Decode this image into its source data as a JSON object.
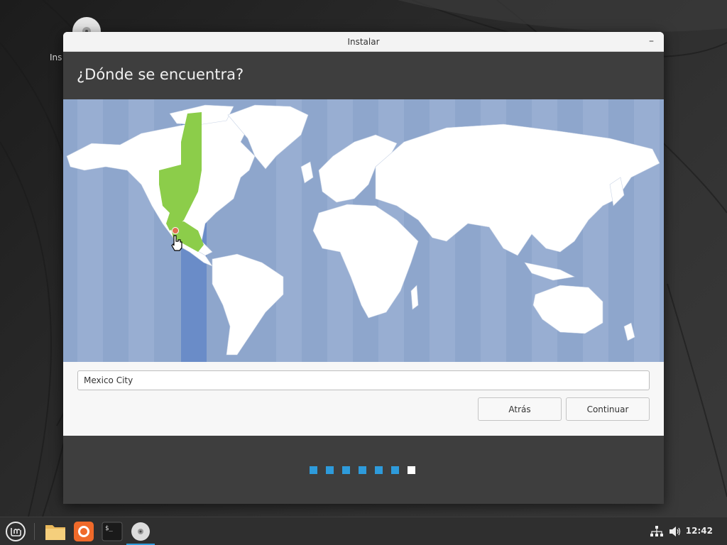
{
  "desktop": {
    "icon_label": "Ins"
  },
  "window": {
    "title": "Instalar",
    "minimize_glyph": "–",
    "heading": "¿Dónde se encuentra?"
  },
  "timezone": {
    "input_value": "Mexico City",
    "selected_region_color": "#8ccd4a",
    "highlight_band_color": "#6a8cc8"
  },
  "buttons": {
    "back_label": "Atrás",
    "continue_label": "Continuar"
  },
  "progress": {
    "total_steps": 7,
    "current_step": 7,
    "step_color": "#2e9bdb",
    "active_color": "#ffffff"
  },
  "taskbar": {
    "apps": [
      {
        "name": "mint-menu-icon"
      },
      {
        "name": "files-icon"
      },
      {
        "name": "firefox-icon"
      },
      {
        "name": "terminal-icon"
      },
      {
        "name": "installer-disc-icon"
      }
    ],
    "clock": "12:42"
  }
}
